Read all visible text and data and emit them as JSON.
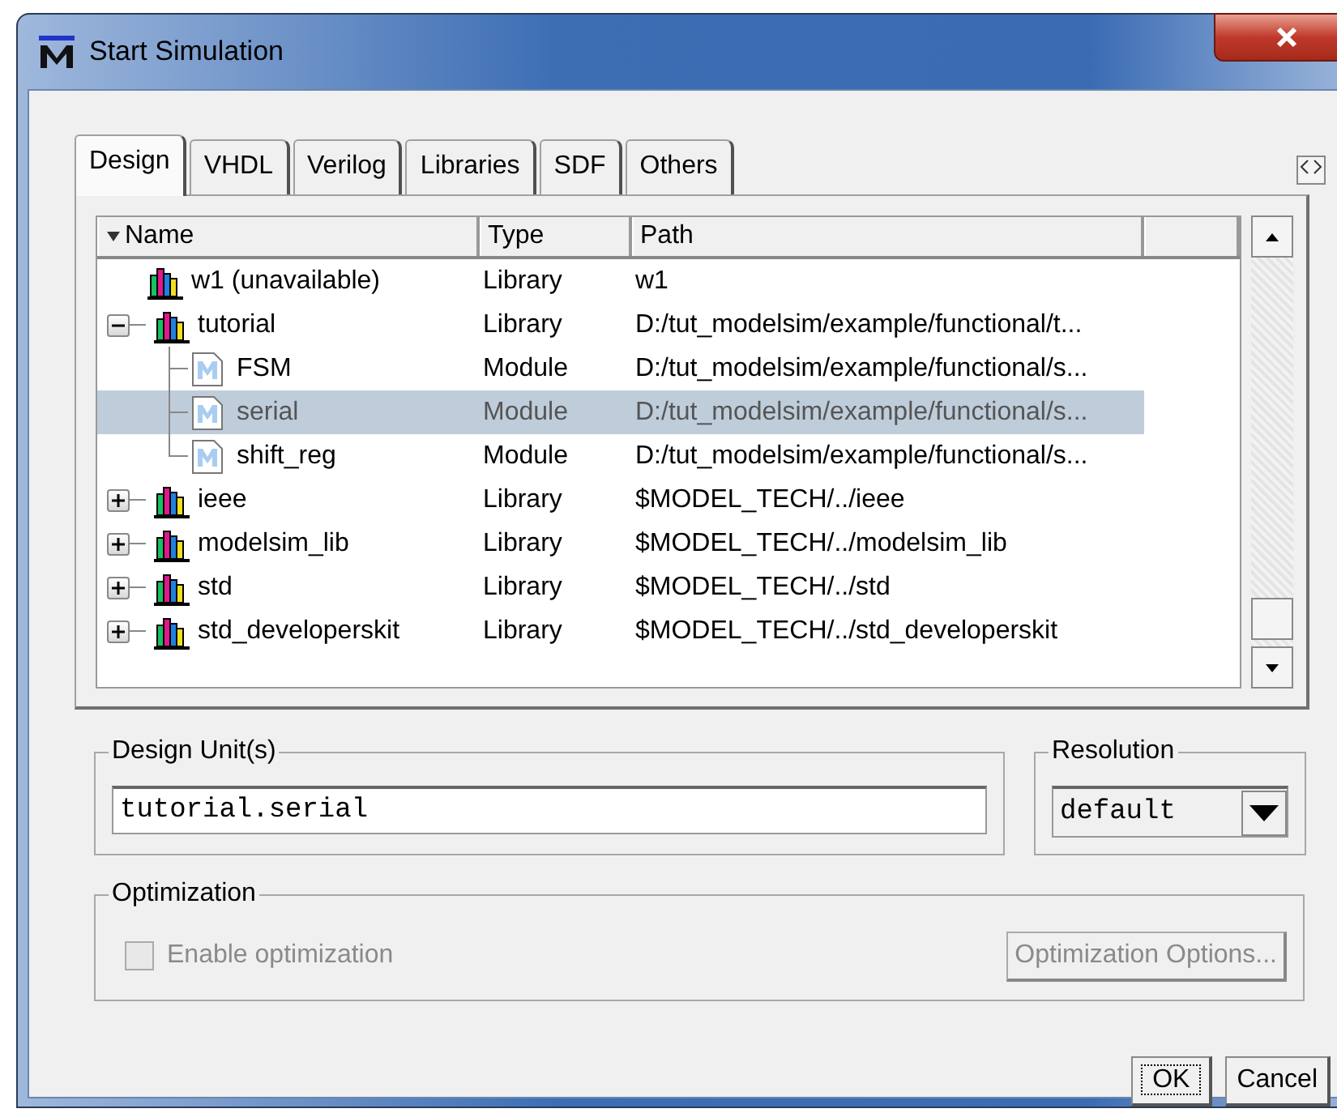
{
  "window": {
    "title": "Start Simulation"
  },
  "tabs": [
    {
      "label": "Design",
      "selected": true
    },
    {
      "label": "VHDL",
      "selected": false
    },
    {
      "label": "Verilog",
      "selected": false
    },
    {
      "label": "Libraries",
      "selected": false
    },
    {
      "label": "SDF",
      "selected": false
    },
    {
      "label": "Others",
      "selected": false
    }
  ],
  "tree": {
    "columns": [
      "Name",
      "Type",
      "Path"
    ],
    "items": [
      {
        "kind": "library",
        "name": "w1  (unavailable)",
        "type": "Library",
        "path": "w1",
        "selected": false
      },
      {
        "kind": "library",
        "name": "tutorial",
        "type": "Library",
        "path": "D:/tut_modelsim/example/functional/t...",
        "selected": false,
        "expanded": true,
        "children": [
          {
            "kind": "module",
            "name": "FSM",
            "type": "Module",
            "path": "D:/tut_modelsim/example/functional/s...",
            "selected": false
          },
          {
            "kind": "module",
            "name": "serial",
            "type": "Module",
            "path": "D:/tut_modelsim/example/functional/s...",
            "selected": true
          },
          {
            "kind": "module",
            "name": "shift_reg",
            "type": "Module",
            "path": "D:/tut_modelsim/example/functional/s...",
            "selected": false
          }
        ]
      },
      {
        "kind": "library",
        "name": "ieee",
        "type": "Library",
        "path": "$MODEL_TECH/../ieee",
        "selected": false,
        "expanded": false
      },
      {
        "kind": "library",
        "name": "modelsim_lib",
        "type": "Library",
        "path": "$MODEL_TECH/../modelsim_lib",
        "selected": false,
        "expanded": false
      },
      {
        "kind": "library",
        "name": "std",
        "type": "Library",
        "path": "$MODEL_TECH/../std",
        "selected": false,
        "expanded": false
      },
      {
        "kind": "library",
        "name": "std_developerskit",
        "type": "Library",
        "path": "$MODEL_TECH/../std_developerskit",
        "selected": false,
        "expanded": false
      }
    ]
  },
  "design_unit": {
    "label": "Design Unit(s)",
    "value": "tutorial.serial"
  },
  "resolution": {
    "label": "Resolution",
    "value": "default"
  },
  "optimization": {
    "label": "Optimization",
    "checkbox": {
      "label": "Enable optimization",
      "checked": false,
      "disabled": true
    },
    "button": {
      "label": "Optimization Options...",
      "disabled": true
    }
  },
  "buttons": [
    {
      "label": "OK",
      "focused": true
    },
    {
      "label": "Cancel",
      "focused": false
    }
  ]
}
